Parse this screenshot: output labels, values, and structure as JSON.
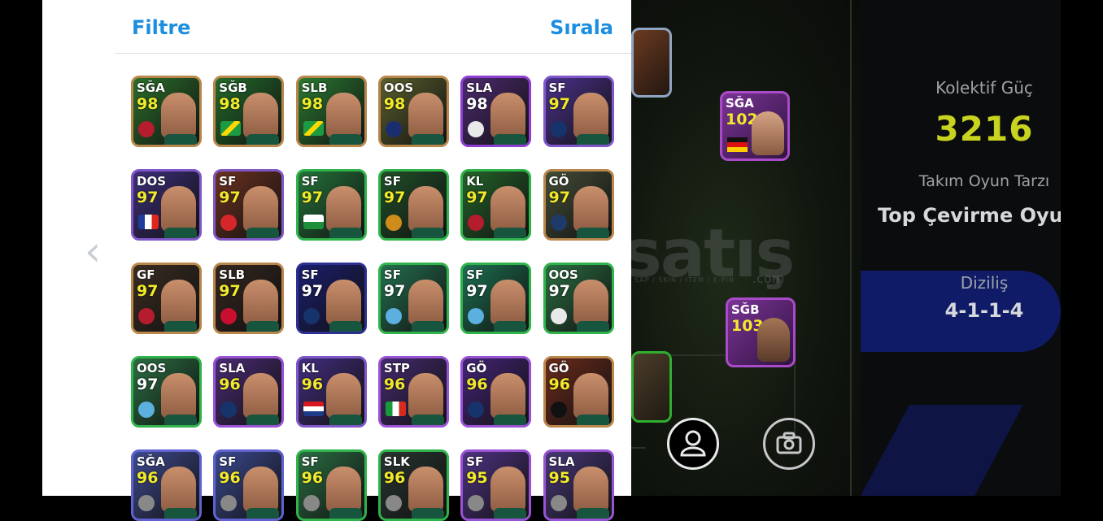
{
  "panel": {
    "filter_label": "Filtre",
    "sort_label": "Sırala"
  },
  "cards": [
    {
      "pos": "SĞA",
      "ovr": "98",
      "flag": "barcelona"
    },
    {
      "pos": "SĞB",
      "ovr": "98",
      "flag": "brazil"
    },
    {
      "pos": "SLB",
      "ovr": "98",
      "flag": "brazil"
    },
    {
      "pos": "OOS",
      "ovr": "98",
      "flag": "inter"
    },
    {
      "pos": "SLA",
      "ovr": "98",
      "flag": "real-madrid"
    },
    {
      "pos": "SF",
      "ovr": "97",
      "flag": "fenerbahce"
    },
    {
      "pos": "DOS",
      "ovr": "97",
      "flag": "france"
    },
    {
      "pos": "SF",
      "ovr": "97",
      "flag": "arsenal"
    },
    {
      "pos": "SF",
      "ovr": "97",
      "flag": "wales"
    },
    {
      "pos": "SF",
      "ovr": "97",
      "flag": "galatasaray"
    },
    {
      "pos": "KL",
      "ovr": "97",
      "flag": "barcelona"
    },
    {
      "pos": "GÖ",
      "ovr": "97",
      "flag": "la-galaxy"
    },
    {
      "pos": "GF",
      "ovr": "97",
      "flag": "barcelona"
    },
    {
      "pos": "SLB",
      "ovr": "97",
      "flag": "ac-milan"
    },
    {
      "pos": "SF",
      "ovr": "97",
      "flag": "psg"
    },
    {
      "pos": "SF",
      "ovr": "97",
      "flag": "manchester-city"
    },
    {
      "pos": "SF",
      "ovr": "97",
      "flag": "manchester-city"
    },
    {
      "pos": "OOS",
      "ovr": "97",
      "flag": "real-madrid"
    },
    {
      "pos": "OOS",
      "ovr": "97",
      "flag": "manchester-city"
    },
    {
      "pos": "SLA",
      "ovr": "96",
      "flag": "fenerbahce"
    },
    {
      "pos": "KL",
      "ovr": "96",
      "flag": "croatia"
    },
    {
      "pos": "STP",
      "ovr": "96",
      "flag": "italy"
    },
    {
      "pos": "GÖ",
      "ovr": "96",
      "flag": "psg"
    },
    {
      "pos": "GÖ",
      "ovr": "96",
      "flag": "besiktas"
    },
    {
      "pos": "SĞA",
      "ovr": "96",
      "flag": "unknown"
    },
    {
      "pos": "SF",
      "ovr": "96",
      "flag": "unknown"
    },
    {
      "pos": "SF",
      "ovr": "96",
      "flag": "unknown"
    },
    {
      "pos": "SLK",
      "ovr": "96",
      "flag": "unknown"
    },
    {
      "pos": "SF",
      "ovr": "95",
      "flag": "unknown"
    },
    {
      "pos": "SLA",
      "ovr": "95",
      "flag": "unknown"
    }
  ],
  "pitch_cards": [
    {
      "pos": "SĞA",
      "ovr": "102",
      "flag": "germany"
    },
    {
      "pos": "SĞB",
      "ovr": "103",
      "flag": "unknown"
    }
  ],
  "team_info": {
    "collective_label": "Kolektif Güç",
    "collective_value": "3216",
    "playstyle_label": "Takım Oyun Tarzı",
    "playstyle_value": "Top Çevirme Oyunu",
    "formation_label": "Diziliş",
    "formation_value": "4-1-1-4"
  },
  "watermark": {
    "text": "satış",
    "com": ".com",
    "sub": "SAP / SKIN / ITEM / E-PIN"
  },
  "colors": {
    "accent": "#1c8ee0",
    "power": "#c8d31f"
  }
}
